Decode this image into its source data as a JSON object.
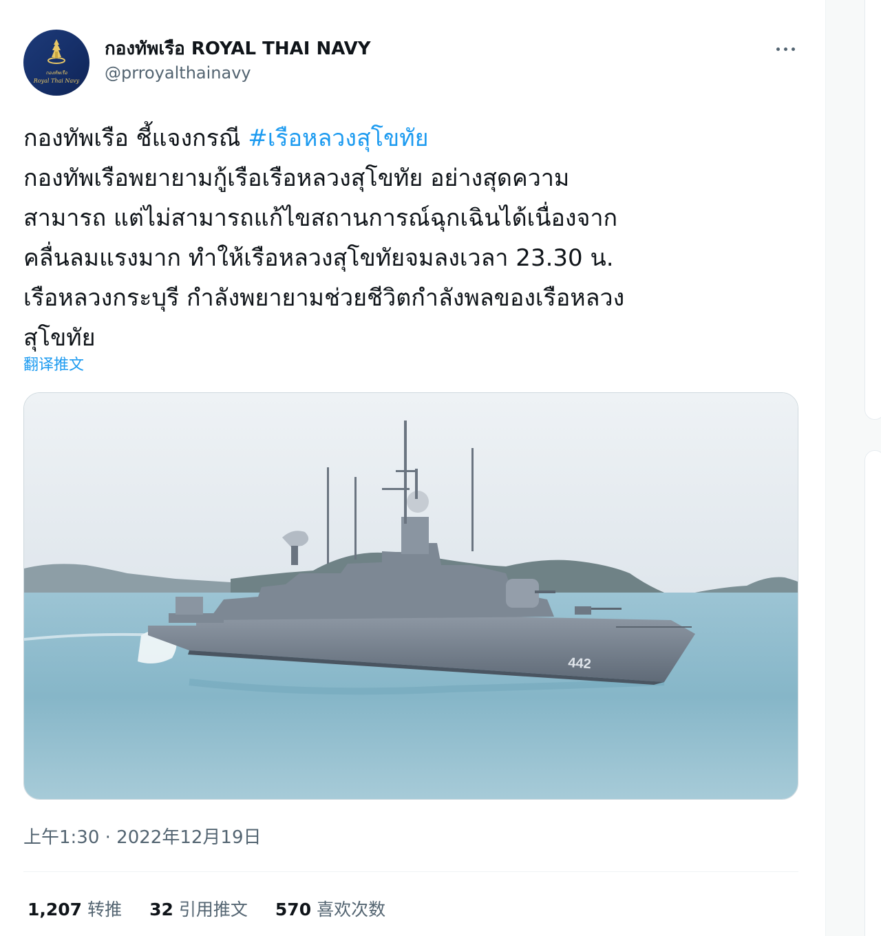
{
  "account": {
    "display_name": "กองทัพเรือ ROYAL THAI NAVY",
    "handle": "@prroyalthainavy",
    "avatar_text": "Royal Thai Navy",
    "avatar_text_thai": "กองทัพเรือ"
  },
  "tweet": {
    "line1_prefix": "กองทัพเรือ ชี้แจงกรณี ",
    "hashtag": "#เรือหลวงสุโขทัย",
    "lines": [
      "กองทัพเรือพยายามกู้เรือเรือหลวงสุโขทัย อย่างสุดความ",
      "สามารถ แต่ไม่สามารถแก้ไขสถานการณ์ฉุกเฉินได้เนื่องจาก",
      "คลื่นลมแรงมาก ทำให้เรือหลวงสุโขทัยจมลงเวลา 23.30 น.",
      "เรือหลวงกระบุรี กำลังพยายามช่วยชีวิตกำลังพลของเรือหลวง",
      "สุโขทัย"
    ],
    "translate_label": "翻译推文",
    "hull_number": "442"
  },
  "meta": {
    "timestamp": "上午1:30 · 2022年12月19日"
  },
  "stats": {
    "retweets_count": "1,207",
    "retweets_label": "转推",
    "quotes_count": "32",
    "quotes_label": "引用推文",
    "likes_count": "570",
    "likes_label": "喜欢次数"
  },
  "colors": {
    "accent": "#1d9bf0",
    "secondary_text": "#536471",
    "primary_text": "#0f1419",
    "avatar_bg": "#1d3a78",
    "avatar_gold": "#e8c766"
  },
  "icons": {
    "more": "more-dots-icon",
    "emblem": "navy-emblem-icon"
  }
}
